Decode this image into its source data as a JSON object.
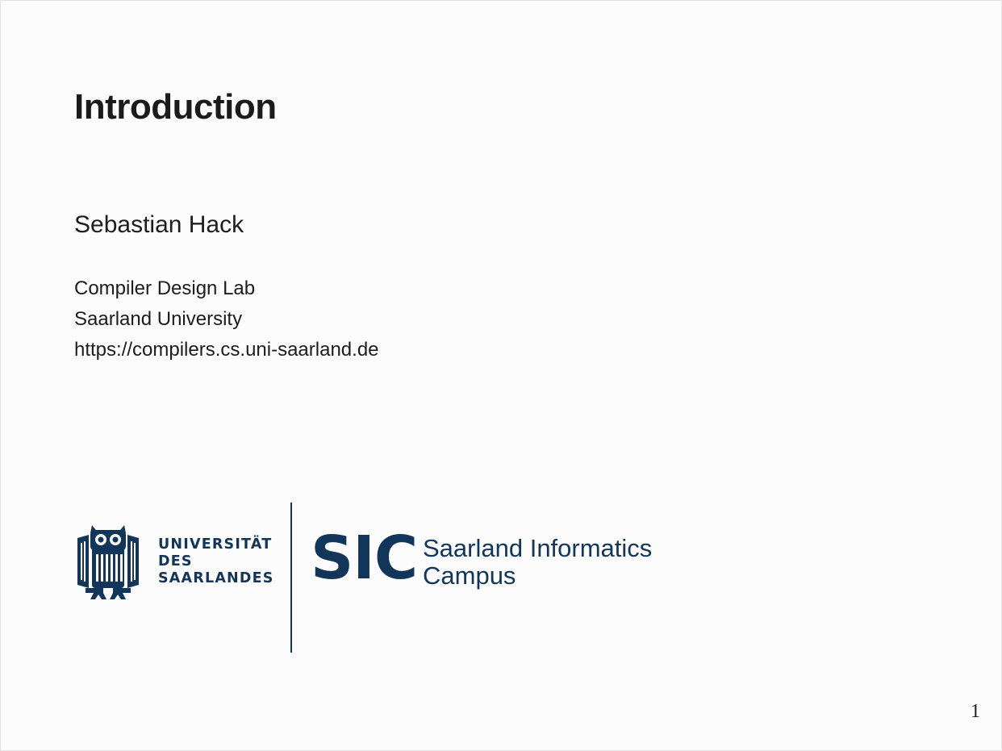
{
  "slide": {
    "title": "Introduction",
    "author": "Sebastian Hack",
    "affiliation": [
      "Compiler Design Lab",
      "Saarland University",
      "https://compilers.cs.uni-saarland.de"
    ],
    "page_number": "1"
  },
  "logos": {
    "uds": {
      "lines": [
        "UNIVERSITÄT",
        "DES",
        "SAARLANDES"
      ],
      "icon": "owl-icon",
      "color": "#123659"
    },
    "sic": {
      "mark": "SIC",
      "lines": [
        "Saarland Informatics",
        "Campus"
      ],
      "color": "#123659"
    }
  }
}
